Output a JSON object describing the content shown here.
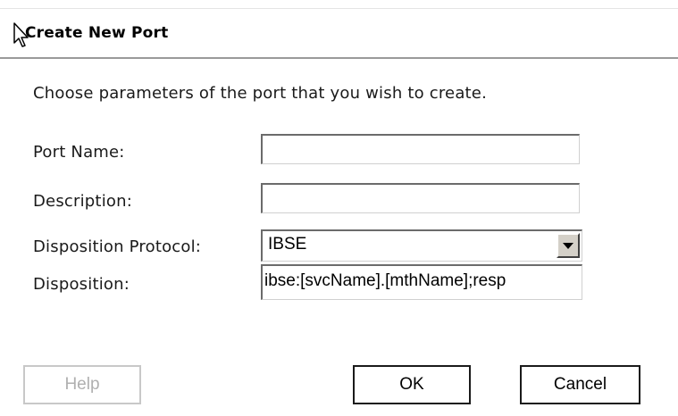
{
  "dialog": {
    "title": "Create New Port",
    "intro": "Choose parameters of the port that you wish to create."
  },
  "form": {
    "port_name_label": "Port Name:",
    "port_name_value": "",
    "description_label": "Description:",
    "description_value": "",
    "disposition_protocol_label": "Disposition Protocol:",
    "disposition_protocol_value": "IBSE",
    "disposition_label": "Disposition:",
    "disposition_value": "ibse:[svcName].[mthName];resp"
  },
  "buttons": {
    "help": "Help",
    "ok": "OK",
    "cancel": "Cancel"
  },
  "icons": {
    "cursor": "mouse-pointer-icon",
    "dropdown": "dropdown-arrow-icon"
  }
}
